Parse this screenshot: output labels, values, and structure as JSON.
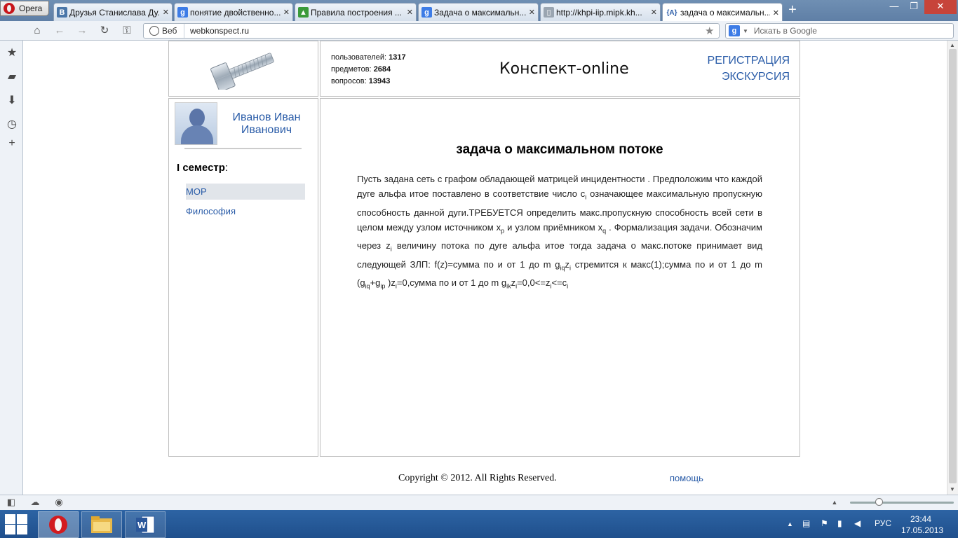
{
  "browser": {
    "menu_label": "Opera",
    "tabs": [
      {
        "title": "Друзья Станислава Ду...",
        "favicon": "vk-icon",
        "favicon_color": "#4a76a8",
        "favicon_glyph": "B"
      },
      {
        "title": "понятие двойственно...",
        "favicon": "google-icon",
        "favicon_color": "#3d7ce6",
        "favicon_glyph": "g"
      },
      {
        "title": "Правила построения ...",
        "favicon": "image-icon",
        "favicon_color": "#3a9a3a",
        "favicon_glyph": "▲"
      },
      {
        "title": "Задача о максимальн...",
        "favicon": "google-icon",
        "favicon_color": "#3d7ce6",
        "favicon_glyph": "g"
      },
      {
        "title": "http://khpi-iip.mipk.kh...",
        "favicon": "page-icon",
        "favicon_color": "#9aa5b1",
        "favicon_glyph": "▯"
      },
      {
        "title": "задача о максимальн...",
        "favicon": "konspekt-icon",
        "favicon_color": "#ffffff",
        "favicon_glyph": "{A}"
      }
    ],
    "address": {
      "scheme_label": "Веб",
      "url": "webkonspect.ru"
    },
    "search_placeholder": "Искать в Google"
  },
  "site": {
    "stats": [
      {
        "label": "пользователей:",
        "value": "1317"
      },
      {
        "label": "предметов:",
        "value": "2684"
      },
      {
        "label": "вопросов:",
        "value": "13943"
      }
    ],
    "title": "Конспект-online",
    "links": {
      "register": "РЕГИСТРАЦИЯ",
      "tour": "ЭКСКУРСИЯ"
    },
    "user": {
      "name_line1": "Иванов Иван",
      "name_line2": "Иванович"
    },
    "semester": {
      "label": "I семестр",
      "colon": ":"
    },
    "subjects": [
      {
        "name": "МОР",
        "selected": true
      },
      {
        "name": "Философия",
        "selected": false
      }
    ],
    "article": {
      "title": "задача о максимальном потоке"
    },
    "footer": {
      "copyright": "Copyright © 2012. All Rights Reserved.",
      "help": "помощь"
    }
  },
  "taskbar": {
    "language": "РУС",
    "time": "23:44",
    "date": "17.05.2013"
  },
  "colors": {
    "link": "#2a5ca8",
    "taskbar": "#2d64a4",
    "selected_subject": "#e1e5ea"
  }
}
